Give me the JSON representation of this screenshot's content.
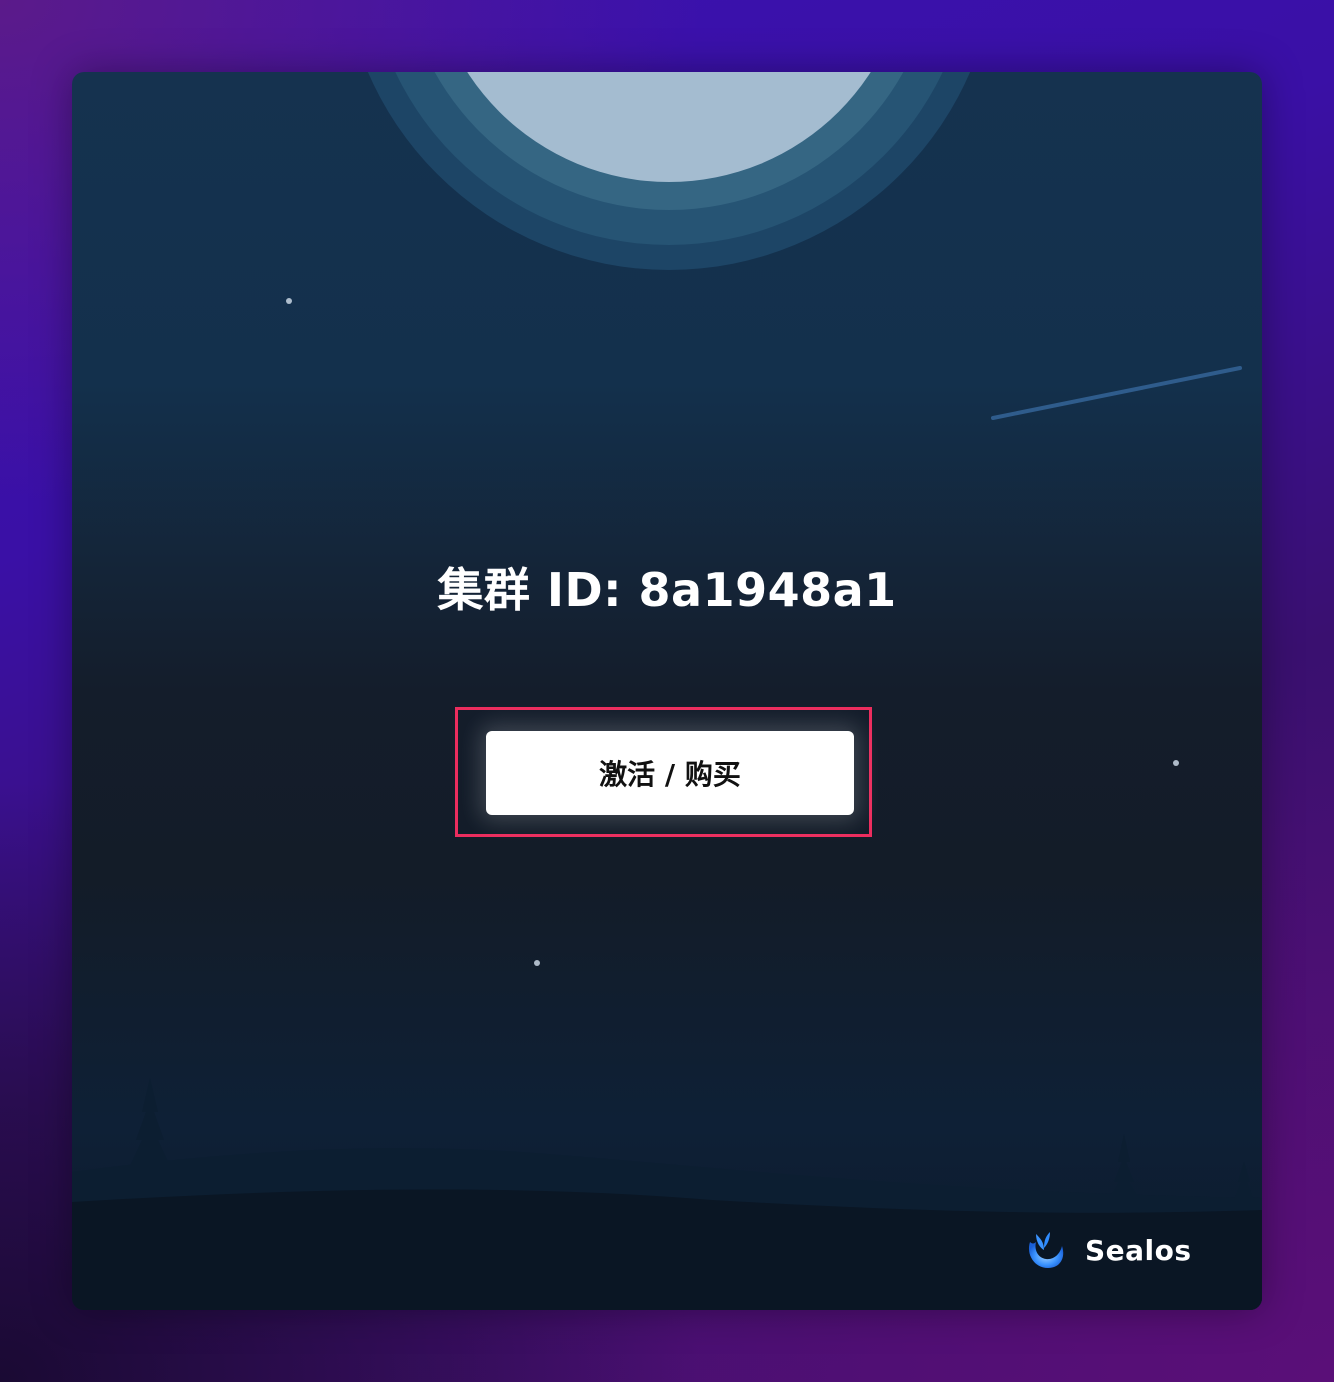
{
  "cluster": {
    "title": "集群 ID: 8a1948a1"
  },
  "actions": {
    "activate_label": "激活 / 购买"
  },
  "brand": {
    "name": "Sealos",
    "logo_icon": "sealos-logo-icon"
  },
  "colors": {
    "highlight": "#ec2d5e",
    "button_bg": "#ffffff",
    "brand_blue": "#2f8cff"
  }
}
